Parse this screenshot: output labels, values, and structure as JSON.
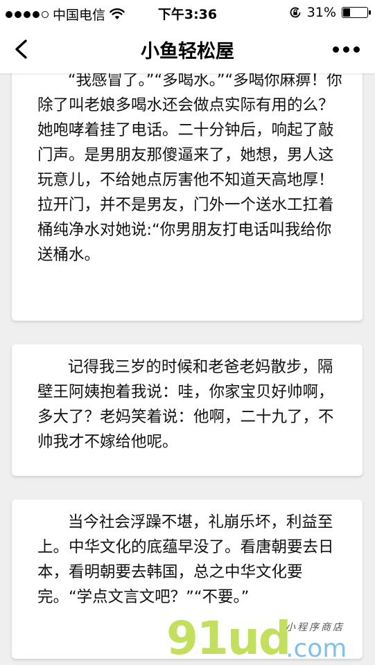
{
  "status_bar": {
    "carrier": "中国电信",
    "time": "下午3:36",
    "battery_percent": "31%",
    "battery_level": 0.31,
    "signal_icon": "signal-dots-icon",
    "wifi_icon": "wifi-icon",
    "lock_icon": "orientation-lock-icon",
    "battery_icon": "battery-icon"
  },
  "nav": {
    "title": "小鱼轻松屋",
    "back_icon": "chevron-left-icon",
    "more_icon": "more-dots-icon"
  },
  "cards": [
    {
      "text": "“我感冒了。”“多喝水。”“多喝你麻痹！你除了叫老娘多喝水还会做点实际有用的么？她咆哮着挂了电话。二十分钟后，响起了敲门声。是男朋友那傻逼来了，她想，男人这玩意儿，不给她点厉害他不知道天高地厚！拉开门，并不是男友，门外一个送水工扛着桶纯净水对她说:“你男朋友打电话叫我给你送桶水。"
    },
    {
      "text": "记得我三岁的时候和老爸老妈散步，隔壁王阿姨抱着我说：哇，你家宝贝好帅啊，多大了？老妈笑着说：他啊，二十九了，不帅我才不嫁给他呢。"
    },
    {
      "text": "当今社会浮躁不堪，礼崩乐坏，利益至上。中华文化的底蕴早没了。看唐朝要去日本，看明朝要去韩国，总之中华文化要完。“学点文言文吧？”“不要。”"
    }
  ],
  "watermark": {
    "main": "91ud",
    "suffix": ".com",
    "tagline": "小程序商店",
    "colors": {
      "main": "#c2e05e",
      "suffix": "#7ec0ee"
    }
  }
}
